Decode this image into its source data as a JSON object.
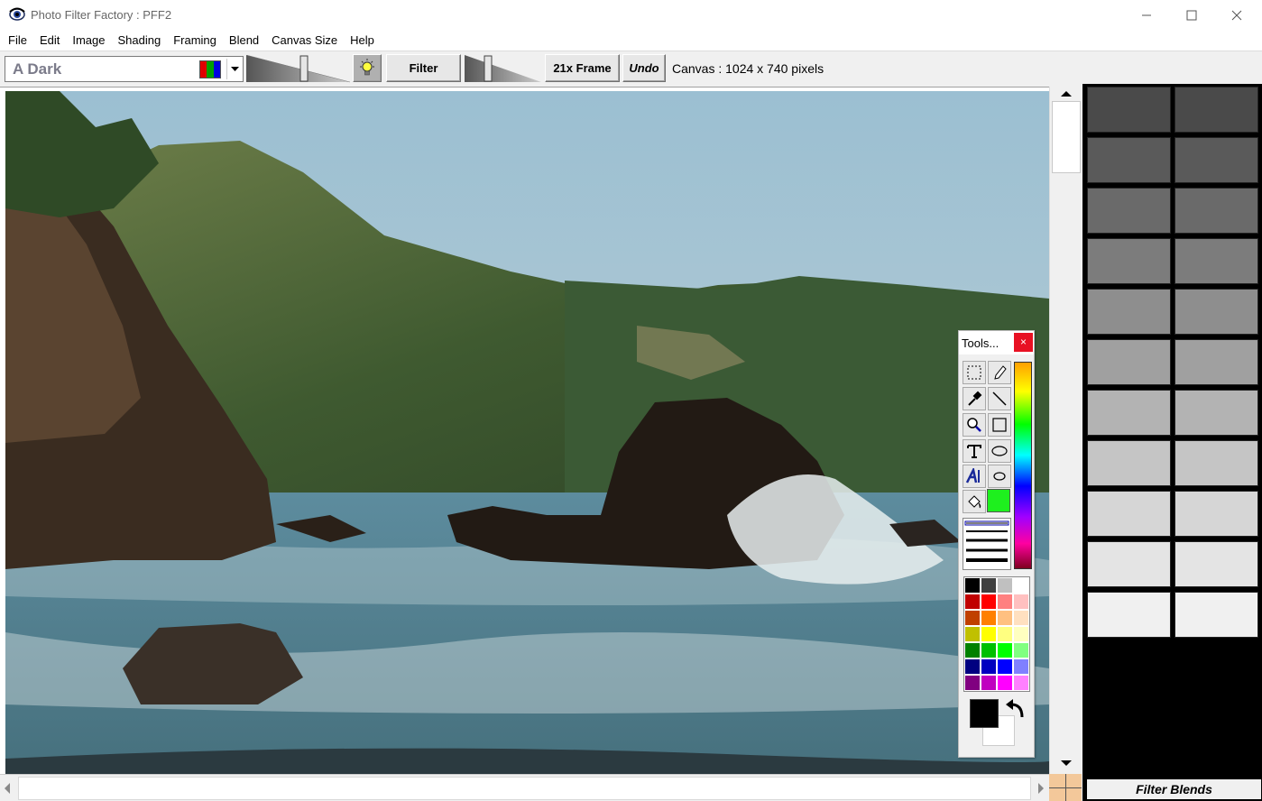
{
  "window": {
    "title": "Photo Filter Factory : PFF2"
  },
  "menu": [
    "File",
    "Edit",
    "Image",
    "Shading",
    "Framing",
    "Blend",
    "Canvas Size",
    "Help"
  ],
  "toolbar": {
    "preset_value": "A Dark",
    "filter_label": "Filter",
    "frame_label": "21x Frame",
    "undo_label": "Undo",
    "canvas_info": "Canvas : 1024 x 740 pixels"
  },
  "tools": {
    "title": "Tools...",
    "close_label": "×",
    "fill_color": "#1ef01e",
    "foreground_color": "#000000",
    "background_color": "#ffffff",
    "palette": [
      "#000000",
      "#404040",
      "#c0c0c0",
      "#ffffff",
      "#c00000",
      "#ff0000",
      "#ff8080",
      "#ffc0c0",
      "#c04000",
      "#ff8000",
      "#ffc080",
      "#ffe0c0",
      "#c0c000",
      "#ffff00",
      "#ffff80",
      "#ffffc0",
      "#008000",
      "#00c000",
      "#00ff00",
      "#80ff80",
      "#000080",
      "#0000c0",
      "#0000ff",
      "#8080ff",
      "#800080",
      "#c000c0",
      "#ff00ff",
      "#ff80ff"
    ]
  },
  "blend_panel": {
    "label": "Filter Blends",
    "tile_shades": [
      "#4a4a4a",
      "#4a4a4a",
      "#5a5a5a",
      "#5a5a5a",
      "#6a6a6a",
      "#6a6a6a",
      "#7c7c7c",
      "#7c7c7c",
      "#8e8e8e",
      "#8e8e8e",
      "#a0a0a0",
      "#a0a0a0",
      "#b3b3b3",
      "#b3b3b3",
      "#c5c5c5",
      "#c5c5c5",
      "#d6d6d6",
      "#d6d6d6",
      "#e4e4e4",
      "#e4e4e4",
      "#f0f0f0",
      "#f0f0f0"
    ]
  }
}
